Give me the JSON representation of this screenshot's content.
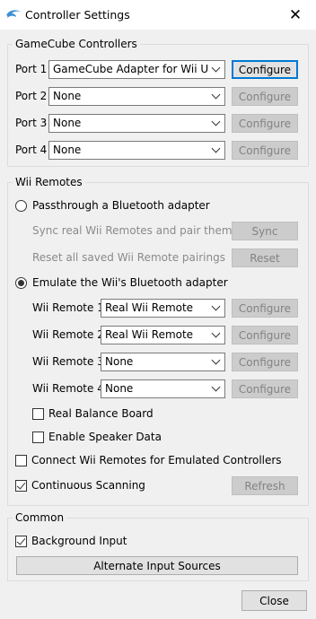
{
  "window": {
    "title": "Controller Settings",
    "close_glyph": "✕"
  },
  "gamecube": {
    "title": "GameCube Controllers",
    "ports": [
      {
        "label": "Port 1",
        "value": "GameCube Adapter for Wii U",
        "button": "Configure",
        "enabled": true
      },
      {
        "label": "Port 2",
        "value": "None",
        "button": "Configure",
        "enabled": false
      },
      {
        "label": "Port 3",
        "value": "None",
        "button": "Configure",
        "enabled": false
      },
      {
        "label": "Port 4",
        "value": "None",
        "button": "Configure",
        "enabled": false
      }
    ]
  },
  "wii": {
    "title": "Wii Remotes",
    "passthrough": {
      "label": "Passthrough a Bluetooth adapter",
      "selected": false
    },
    "sync": {
      "label": "Sync real Wii Remotes and pair them",
      "button": "Sync"
    },
    "reset": {
      "label": "Reset all saved Wii Remote pairings",
      "button": "Reset"
    },
    "emulate": {
      "label": "Emulate the Wii's Bluetooth adapter",
      "selected": true
    },
    "remotes": [
      {
        "label": "Wii Remote 1",
        "value": "Real Wii Remote",
        "button": "Configure"
      },
      {
        "label": "Wii Remote 2",
        "value": "Real Wii Remote",
        "button": "Configure"
      },
      {
        "label": "Wii Remote 3",
        "value": "None",
        "button": "Configure"
      },
      {
        "label": "Wii Remote 4",
        "value": "None",
        "button": "Configure"
      }
    ],
    "balance_board": {
      "label": "Real Balance Board",
      "checked": false
    },
    "speaker_data": {
      "label": "Enable Speaker Data",
      "checked": false
    },
    "connect_emulated": {
      "label": "Connect Wii Remotes for Emulated Controllers",
      "checked": false
    },
    "continuous_scanning": {
      "label": "Continuous Scanning",
      "checked": true
    },
    "refresh_button": "Refresh"
  },
  "common": {
    "title": "Common",
    "background_input": {
      "label": "Background Input",
      "checked": true
    },
    "alt_sources_button": "Alternate Input Sources"
  },
  "footer": {
    "close_button": "Close"
  },
  "colors": {
    "accent": "#0078d7",
    "dolphin_blue": "#3c8fd4"
  }
}
